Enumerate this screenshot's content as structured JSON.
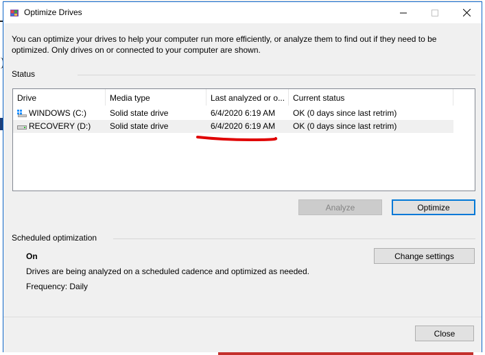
{
  "window": {
    "title": "Optimize Drives",
    "accent": "#0078d7",
    "description": "You can optimize your drives to help your computer run more efficiently, or analyze them to find out if they need to be optimized. Only drives on or connected to your computer are shown."
  },
  "status": {
    "label": "Status",
    "columns": [
      "Drive",
      "Media type",
      "Last analyzed or o...",
      "Current status"
    ],
    "drives": [
      {
        "icon": "windows-drive-icon",
        "name": "WINDOWS (C:)",
        "media": "Solid state drive",
        "last": "6/4/2020 6:19 AM",
        "status": "OK (0 days since last retrim)"
      },
      {
        "icon": "drive-icon",
        "name": "RECOVERY (D:)",
        "media": "Solid state drive",
        "last": "6/4/2020 6:19 AM",
        "status": "OK (0 days since last retrim)"
      }
    ]
  },
  "buttons": {
    "analyze": "Analyze",
    "optimize": "Optimize",
    "change_settings": "Change settings",
    "close": "Close"
  },
  "schedule": {
    "label": "Scheduled optimization",
    "state": "On",
    "description": "Drives are being analyzed on a scheduled cadence and optimized as needed.",
    "frequency": "Frequency: Daily"
  },
  "annotation": {
    "color": "#e00000"
  }
}
